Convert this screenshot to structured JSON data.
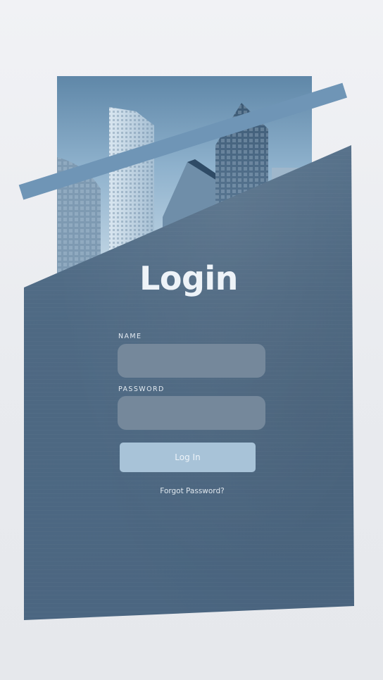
{
  "form": {
    "title": "Login",
    "name_label": "NAME",
    "password_label": "PASSWORD",
    "name_value": "",
    "password_value": "",
    "login_button": "Log In",
    "forgot_link": "Forgot Password?"
  },
  "colors": {
    "panel": "#4e6983",
    "accent_stripe": "#6f95b6",
    "button": "#a8c3d8",
    "field": "#75889b",
    "text": "#eef3f8"
  }
}
